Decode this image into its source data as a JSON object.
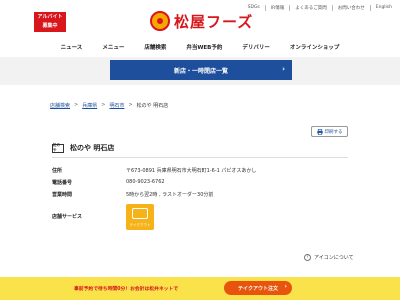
{
  "header": {
    "job_badge": "アルバイト\n募集中",
    "logo_text": "松屋フーズ",
    "top_links": [
      "SDGs",
      "IR情報",
      "よくあるご質問",
      "お問い合わせ",
      "English"
    ]
  },
  "nav": {
    "items": [
      "ニュース",
      "メニュー",
      "店舗検索",
      "弁当WEB予約",
      "デリバリー",
      "オンラインショップ"
    ]
  },
  "closure": {
    "label": "新店・一時閉店一覧",
    "chevron": "›"
  },
  "breadcrumb": {
    "items": [
      "店舗検索",
      "兵庫県",
      "明石市"
    ],
    "separator": ">",
    "current": "松のや 明石店"
  },
  "print_button": {
    "icon": "print-icon",
    "label": "印刷する"
  },
  "store": {
    "brand_badge": "松のや",
    "name": "松のや 明石店"
  },
  "info": {
    "address_label": "住所",
    "address": "〒673-0891 兵庫県明石市大明石町1-6-1 パピオスあかし",
    "phone_label": "電話番号",
    "phone": "080-9023-6762",
    "hours_label": "営業時間",
    "hours": "5時から翌2時 , ラストオーダー30分前",
    "services_label": "店舗サービス",
    "service_caption": "テイクアウト"
  },
  "icon_legend": {
    "icon": "question-circle-icon",
    "symbol": "?",
    "label": "アイコンについて"
  },
  "footer": {
    "promo": "事前予約で待ち時間0分！お会計は松弁ネットで",
    "takeout_label": "テイクアウト注文",
    "chevron": "›"
  },
  "colors": {
    "brand_red": "#d8161b",
    "brand_yellow": "#f6a800",
    "nav_blue": "#1d4f9c",
    "footer_yellow": "#f9e24a",
    "takeout_orange": "#e8540e"
  }
}
